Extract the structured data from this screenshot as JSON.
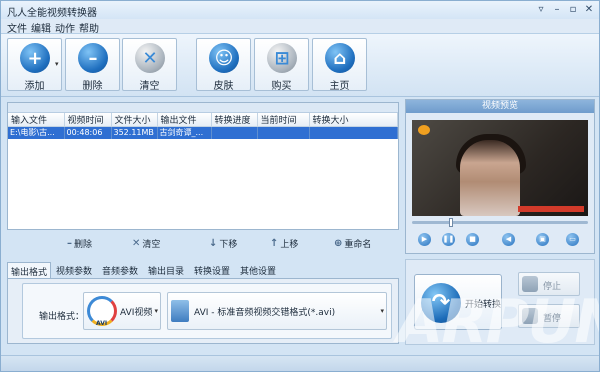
{
  "window": {
    "title": "凡人全能视频转换器",
    "controls": [
      "settings",
      "minimize",
      "restore",
      "close"
    ]
  },
  "menu": [
    "文件",
    "编辑",
    "动作",
    "帮助"
  ],
  "toolbar": {
    "add": "添加",
    "delete": "删除",
    "clear": "清空",
    "skin": "皮肤",
    "buy": "购买",
    "home": "主页"
  },
  "file_list": {
    "columns": [
      "输入文件",
      "视频时间",
      "文件大小",
      "输出文件",
      "转换进度",
      "当前时间",
      "转换大小"
    ],
    "rows": [
      [
        "E:\\电影\\古...",
        "00:48:06",
        "352.11MB",
        "古剑奇谭_...",
        "",
        "",
        ""
      ]
    ]
  },
  "actions": {
    "delete": "删除",
    "clear": "清空",
    "move_down": "下移",
    "move_up": "上移",
    "rename": "重命名"
  },
  "tabs": [
    "输出格式",
    "视频参数",
    "音频参数",
    "输出目录",
    "转换设置",
    "其他设置"
  ],
  "output": {
    "label": "输出格式：",
    "format_short": "AVI视频",
    "format_long": "AVI - 标准音频视频交错格式(*.avi)",
    "logo_text": "AVI"
  },
  "preview": {
    "title": "视频预览",
    "position": 0.22,
    "controls": [
      "play",
      "pause",
      "stop",
      "volume",
      "screenshot",
      "folder"
    ]
  },
  "convert": {
    "start": "开始转换",
    "stop": "停止",
    "pause": "暂停"
  },
  "watermark": "ARPUN",
  "icons": {
    "add": "plus-icon",
    "delete": "minus-icon",
    "clear": "x-icon",
    "skin": "smiley-icon",
    "buy": "cart-icon",
    "home": "house-icon"
  }
}
